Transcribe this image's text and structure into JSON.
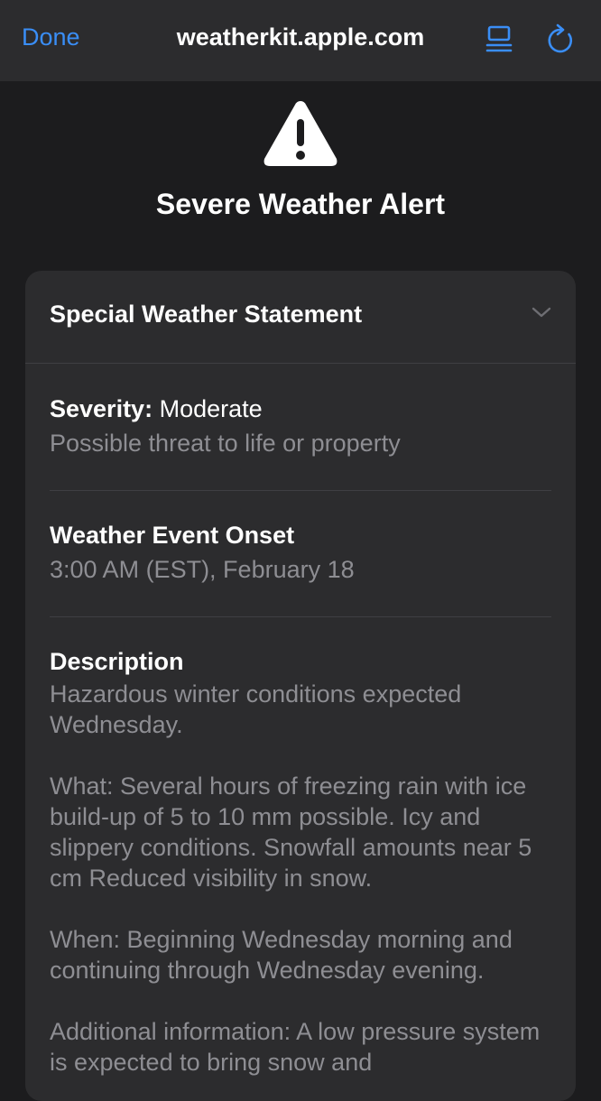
{
  "browser": {
    "done_label": "Done",
    "url": "weatherkit.apple.com",
    "reader_icon": "reader-icon",
    "reload_icon": "reload-icon",
    "accent_color": "#3a8ef6"
  },
  "alert": {
    "icon": "warning-icon",
    "title": "Severe Weather Alert"
  },
  "statement": {
    "title": "Special Weather Statement",
    "expand_icon": "chevron-down-icon",
    "severity": {
      "label": "Severity:",
      "value": "Moderate",
      "detail": "Possible threat to life or property"
    },
    "onset": {
      "label": "Weather Event Onset",
      "value": "3:00 AM (EST), February 18"
    },
    "description": {
      "label": "Description",
      "paragraphs": [
        "Hazardous winter conditions expected Wednesday.",
        "What: Several hours of freezing rain with ice build-up of 5 to 10 mm possible. Icy and slippery conditions. Snowfall amounts near 5 cm Reduced visibility in snow.",
        "When: Beginning Wednesday morning and continuing through Wednesday evening.",
        "Additional information: A low pressure system is expected to bring snow and"
      ]
    }
  }
}
